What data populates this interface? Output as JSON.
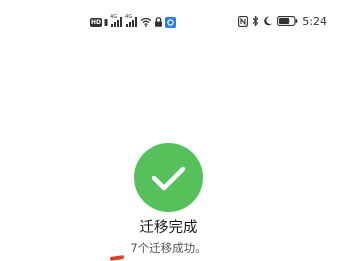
{
  "status_bar": {
    "hd_label": "HD",
    "sim1_network": "4G",
    "sim2_network": "4G",
    "time": "5:24",
    "battery_level_percent": 70
  },
  "result": {
    "title": "迁移完成",
    "message": "7个迁移成功。"
  },
  "colors": {
    "success": "#56c05b",
    "accent_red": "#e0412c"
  }
}
